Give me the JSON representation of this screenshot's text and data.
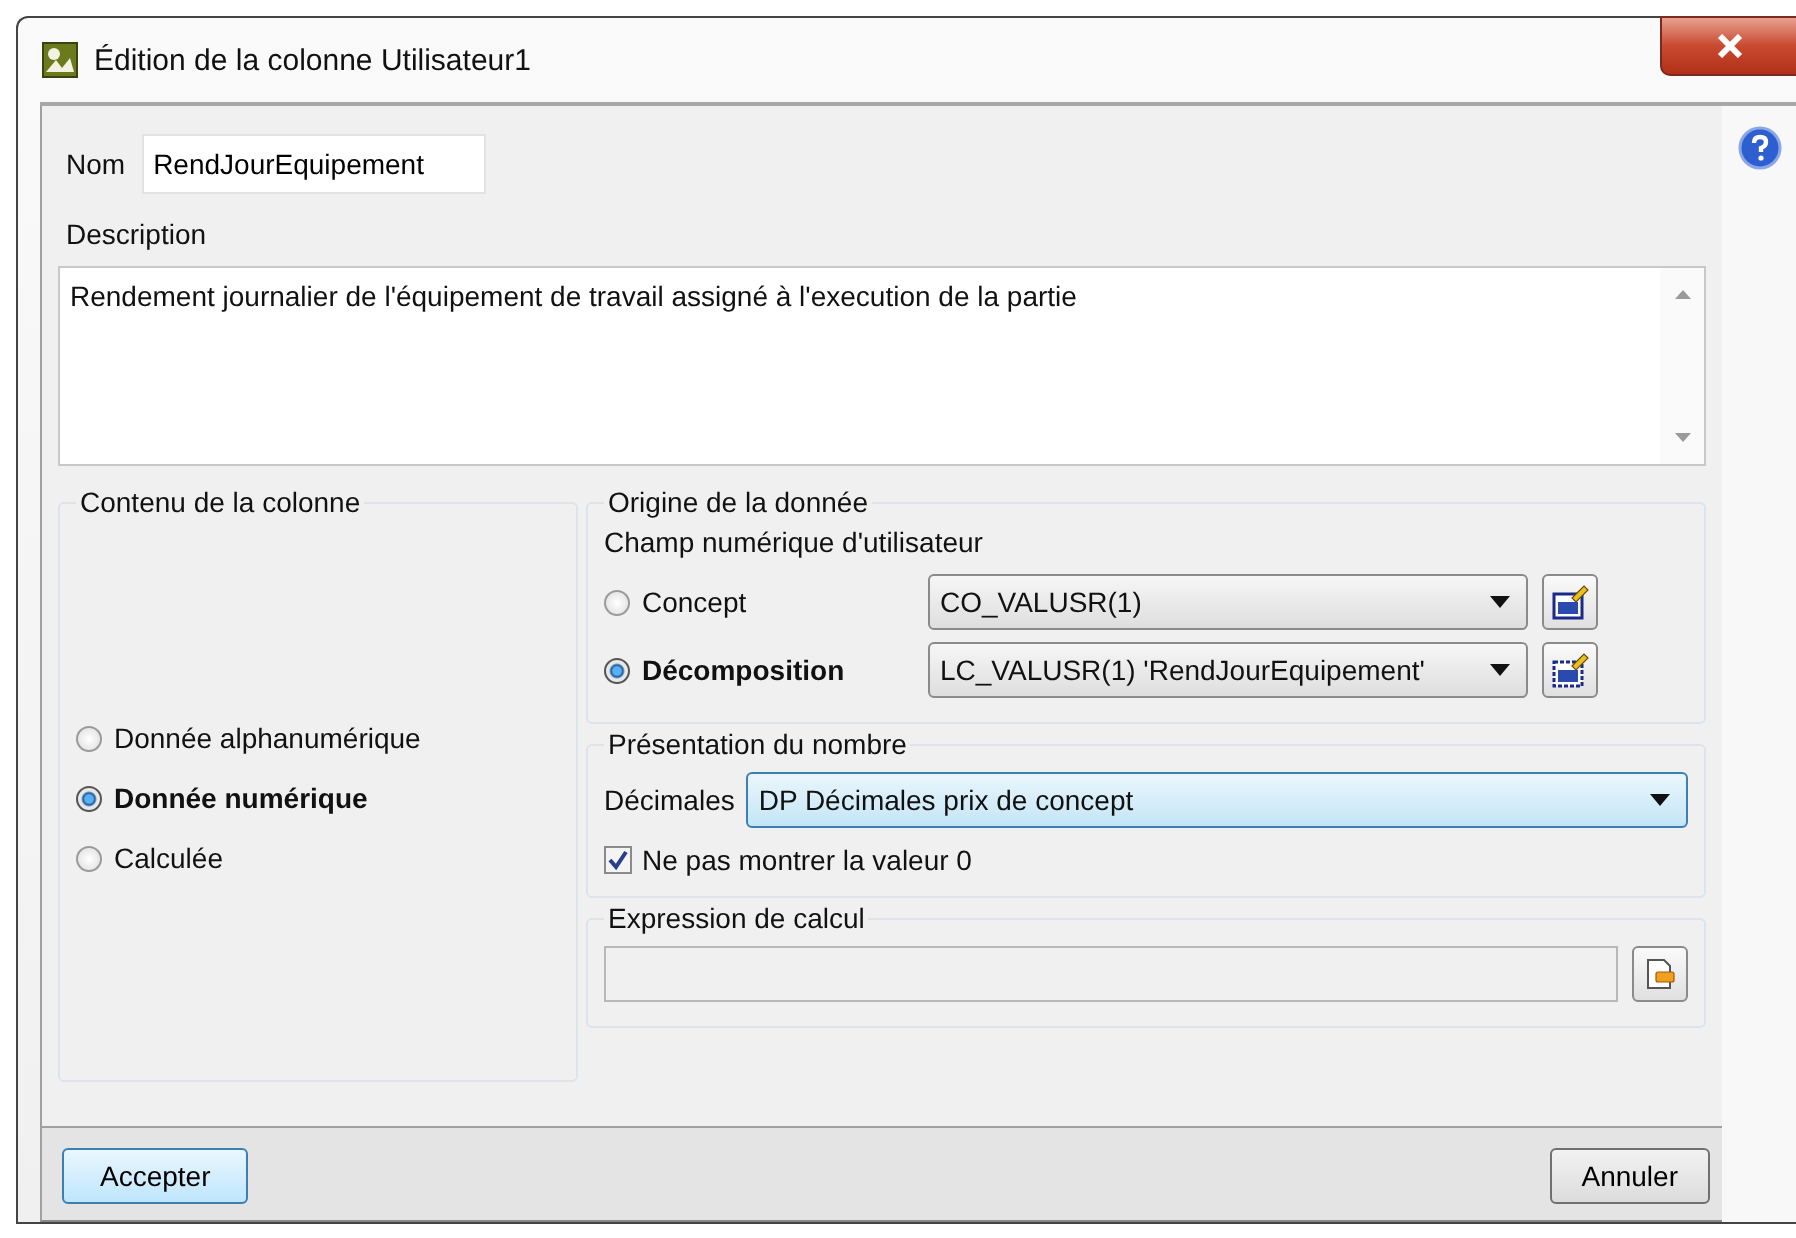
{
  "window": {
    "title": "Édition de la colonne Utilisateur1"
  },
  "name": {
    "label": "Nom",
    "value": "RendJourEquipement"
  },
  "description": {
    "label": "Description",
    "value": "Rendement journalier de l'équipement de travail assigné à l'execution de la partie"
  },
  "column_content": {
    "title": "Contenu de la colonne",
    "options": [
      {
        "label": "Donnée alphanumérique",
        "selected": false
      },
      {
        "label": "Donnée numérique",
        "selected": true
      },
      {
        "label": "Calculée",
        "selected": false
      }
    ]
  },
  "data_origin": {
    "title": "Origine de la donnée",
    "subtitle": "Champ numérique d'utilisateur",
    "options": [
      {
        "label": "Concept",
        "selected": false,
        "value": "CO_VALUSR(1)"
      },
      {
        "label": "Décomposition",
        "selected": true,
        "value": "LC_VALUSR(1) 'RendJourEquipement'"
      }
    ]
  },
  "number_format": {
    "title": "Présentation du nombre",
    "decimals_label": "Décimales",
    "decimals_value": "DP Décimales prix de concept",
    "decimals_focused": true,
    "hide_zero": {
      "label": "Ne pas montrer la valeur 0",
      "checked": true
    }
  },
  "calc_expression": {
    "title": "Expression de calcul",
    "disabled": true
  },
  "buttons": [
    {
      "label": "Accepter",
      "default": true
    },
    {
      "label": "Annuler",
      "default": false
    }
  ]
}
